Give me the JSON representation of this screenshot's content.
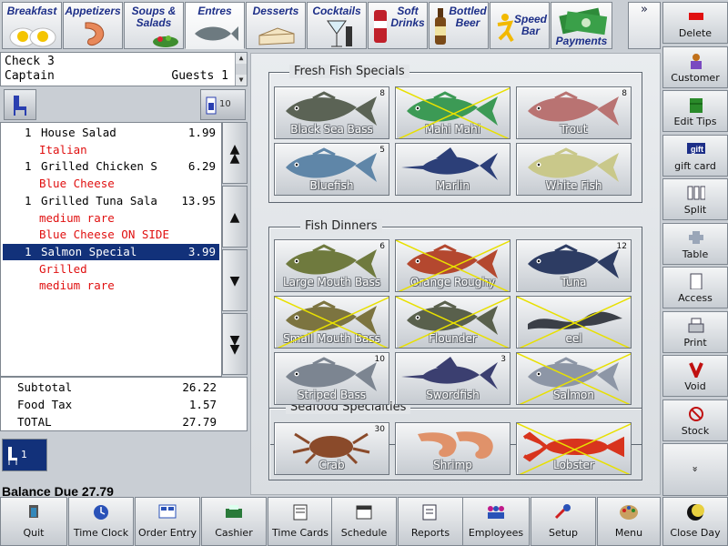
{
  "categories": [
    {
      "label": "Breakfast",
      "icon": "eggs-icon"
    },
    {
      "label": "Appetizers",
      "icon": "shrimp-icon"
    },
    {
      "label": "Soups &\nSalads",
      "icon": "salad-icon"
    },
    {
      "label": "Entres",
      "icon": "fish-icon"
    },
    {
      "label": "Desserts",
      "icon": "cake-icon"
    },
    {
      "label": "Cocktails",
      "icon": "cocktail-icon"
    },
    {
      "label": "Soft\nDrinks",
      "icon": "soda-icon"
    },
    {
      "label": "Bottled\nBeer",
      "icon": "beer-icon"
    },
    {
      "label": "Speed\nBar",
      "icon": "speed-bar-icon"
    },
    {
      "label": "Payments",
      "icon": "money-icon"
    }
  ],
  "more_label": "»",
  "check": {
    "number_label": "Check 3",
    "server": "Captain",
    "guests_label": "Guests 1",
    "seat_count": "10"
  },
  "order_lines": [
    {
      "qty": "1",
      "name": "House Salad",
      "price": "1.99",
      "modifier": false,
      "selected": false
    },
    {
      "qty": "",
      "name": "Italian",
      "price": "",
      "modifier": true,
      "selected": false
    },
    {
      "qty": "1",
      "name": "Grilled Chicken S",
      "price": "6.29",
      "modifier": false,
      "selected": false
    },
    {
      "qty": "",
      "name": "Blue Cheese",
      "price": "",
      "modifier": true,
      "selected": false
    },
    {
      "qty": "1",
      "name": "Grilled Tuna Sala",
      "price": "13.95",
      "modifier": false,
      "selected": false
    },
    {
      "qty": "",
      "name": "medium rare",
      "price": "",
      "modifier": true,
      "selected": false
    },
    {
      "qty": "",
      "name": "Blue Cheese ON SIDE",
      "price": "",
      "modifier": true,
      "selected": false
    },
    {
      "qty": "1",
      "name": "Salmon Special",
      "price": "3.99",
      "modifier": false,
      "selected": true
    },
    {
      "qty": "",
      "name": "Grilled",
      "price": "",
      "modifier": true,
      "selected": false
    },
    {
      "qty": "",
      "name": "medium rare",
      "price": "",
      "modifier": true,
      "selected": false
    }
  ],
  "totals": {
    "subtotal_label": "Subtotal",
    "subtotal": "26.22",
    "tax_label": "Food Tax",
    "tax": "1.57",
    "total_label": "TOTAL",
    "total": "27.79"
  },
  "seat_indicator": "1",
  "balance_due": "Balance Due  27.79",
  "menu_groups": [
    {
      "title": "Fresh Fish Specials",
      "items": [
        {
          "name": "Black Sea Bass",
          "count": "8",
          "unavailable": false,
          "color": "#5b6355"
        },
        {
          "name": "Mahi Mahi",
          "count": "",
          "unavailable": true,
          "color": "#3c9a55"
        },
        {
          "name": "Trout",
          "count": "8",
          "unavailable": false,
          "color": "#b97372"
        },
        {
          "name": "Bluefish",
          "count": "5",
          "unavailable": false,
          "color": "#5f86a8"
        },
        {
          "name": "Marlin",
          "count": "",
          "unavailable": false,
          "color": "#2c3f78"
        },
        {
          "name": "White Fish",
          "count": "",
          "unavailable": false,
          "color": "#c9c88a"
        }
      ]
    },
    {
      "title": "Fish Dinners",
      "items": [
        {
          "name": "Large Mouth Bass",
          "count": "6",
          "unavailable": false,
          "color": "#6f7a3e"
        },
        {
          "name": "Orange Roughy",
          "count": "",
          "unavailable": true,
          "color": "#b4482f"
        },
        {
          "name": "Tuna",
          "count": "12",
          "unavailable": false,
          "color": "#2d3c63"
        },
        {
          "name": "Small Mouth Bass",
          "count": "",
          "unavailable": true,
          "color": "#7c7440"
        },
        {
          "name": "Flounder",
          "count": "",
          "unavailable": true,
          "color": "#59604c"
        },
        {
          "name": "eel",
          "count": "",
          "unavailable": true,
          "color": "#3b3f47"
        },
        {
          "name": "Striped Bass",
          "count": "10",
          "unavailable": false,
          "color": "#7c8591"
        },
        {
          "name": "Swordfish",
          "count": "3",
          "unavailable": false,
          "color": "#3b3f70"
        },
        {
          "name": "Salmon",
          "count": "",
          "unavailable": true,
          "color": "#8d96a6"
        }
      ]
    },
    {
      "title": "Seafood Specialties",
      "items": [
        {
          "name": "Crab",
          "count": "30",
          "unavailable": false,
          "color": "#8a4a2a"
        },
        {
          "name": "Shrimp",
          "count": "",
          "unavailable": false,
          "color": "#e0926a"
        },
        {
          "name": "Lobster",
          "count": "",
          "unavailable": true,
          "color": "#d8341d"
        }
      ]
    }
  ],
  "right_actions": [
    {
      "label": "Delete",
      "icon": "delete-icon"
    },
    {
      "label": "Customer",
      "icon": "customer-icon"
    },
    {
      "label": "Edit Tips",
      "icon": "tips-icon"
    },
    {
      "label": "gift card",
      "icon": "gift-card-icon",
      "badge": "gift"
    },
    {
      "label": "Split",
      "icon": "split-icon"
    },
    {
      "label": "Table",
      "icon": "table-icon"
    },
    {
      "label": "Access",
      "icon": "access-icon"
    },
    {
      "label": "Print",
      "icon": "printer-icon"
    },
    {
      "label": "Void",
      "icon": "void-icon"
    },
    {
      "label": "Stock",
      "icon": "stock-icon"
    }
  ],
  "right_more": "»",
  "bottom_actions": [
    {
      "label": "Quit",
      "icon": "quit-icon"
    },
    {
      "label": "Time Clock",
      "icon": "clock-icon"
    },
    {
      "label": "Order Entry",
      "icon": "order-entry-icon"
    },
    {
      "label": "Cashier",
      "icon": "cash-register-icon"
    },
    {
      "label": "Time Cards",
      "icon": "time-cards-icon"
    },
    {
      "label": "Schedule",
      "icon": "calendar-icon"
    },
    {
      "label": "Reports",
      "icon": "reports-icon"
    },
    {
      "label": "Employees",
      "icon": "employees-icon"
    },
    {
      "label": "Setup",
      "icon": "setup-icon"
    },
    {
      "label": "Menu",
      "icon": "palette-icon"
    },
    {
      "label": "Close Day",
      "icon": "moon-icon"
    }
  ]
}
